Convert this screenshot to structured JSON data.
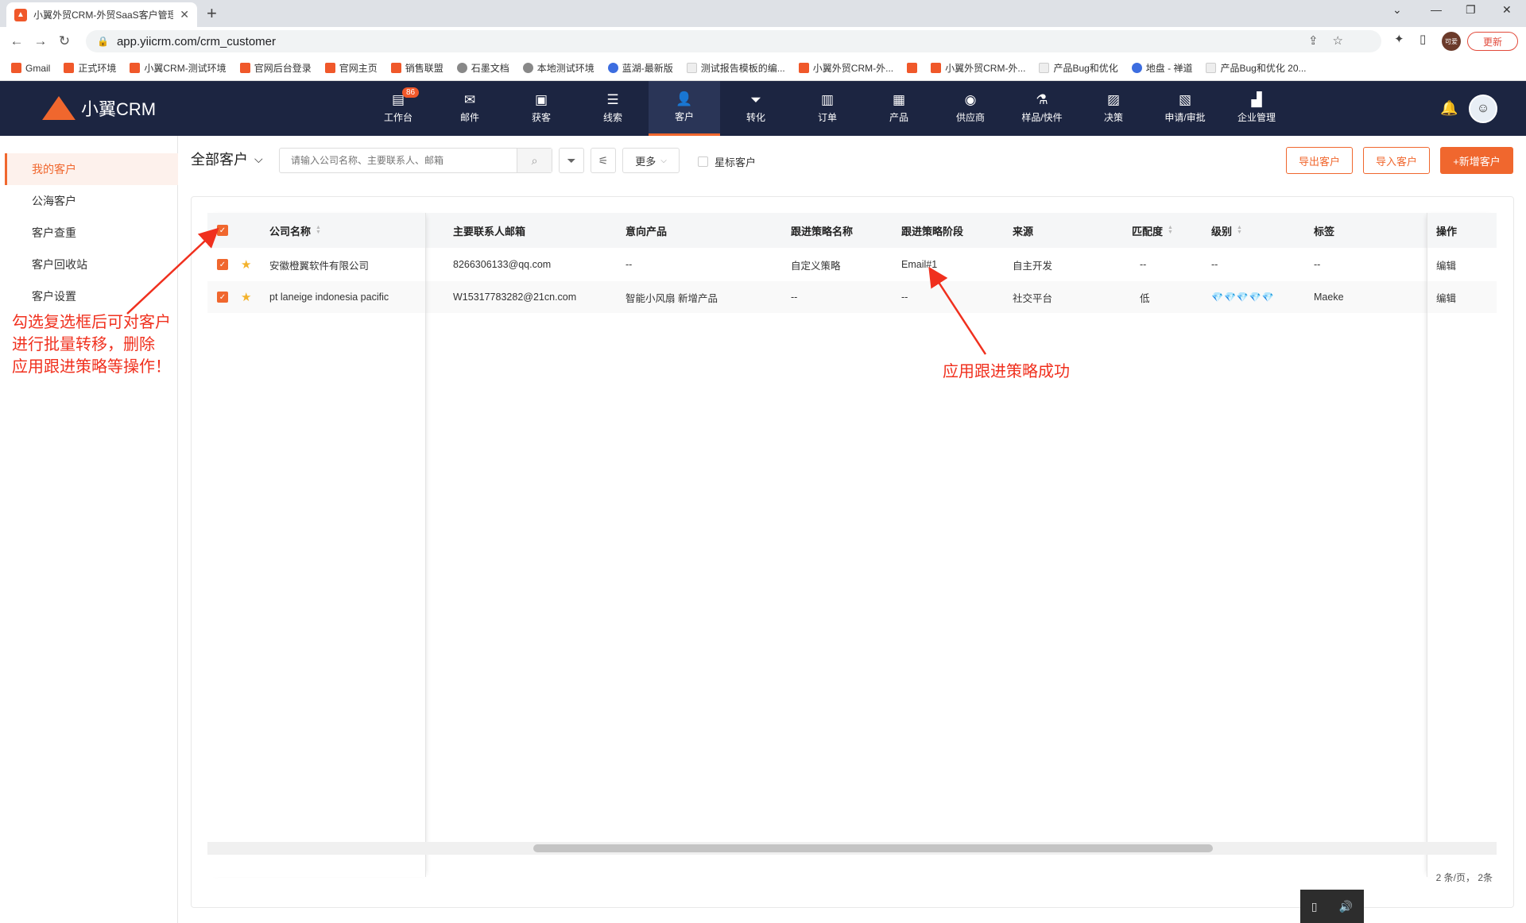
{
  "browser": {
    "tab_title": "小翼外贸CRM-外贸SaaS客户管理",
    "url": "app.yiicrm.com/crm_customer",
    "update_label": "更新",
    "profile_label": "可爱",
    "bookmarks": [
      {
        "label": "Gmail",
        "icon": "gmail-icon"
      },
      {
        "label": "正式环境",
        "icon": "app-icon"
      },
      {
        "label": "小翼CRM-测试环境",
        "icon": "app-icon"
      },
      {
        "label": "官网后台登录",
        "icon": "app-icon"
      },
      {
        "label": "官网主页",
        "icon": "app-icon"
      },
      {
        "label": "销售联盟",
        "icon": "app-icon"
      },
      {
        "label": "石墨文档",
        "icon": "globe-icon"
      },
      {
        "label": "本地测试环境",
        "icon": "globe-icon"
      },
      {
        "label": "蓝湖-最新版",
        "icon": "lanhu-icon"
      },
      {
        "label": "测试报告模板的编...",
        "icon": "doc-icon"
      },
      {
        "label": "小翼外贸CRM-外...",
        "icon": "app-icon"
      },
      {
        "label": "",
        "icon": "app-icon"
      },
      {
        "label": "小翼外贸CRM-外...",
        "icon": "app-icon"
      },
      {
        "label": "产品Bug和优化",
        "icon": "doc-icon"
      },
      {
        "label": "地盘 - 禅道",
        "icon": "blue-icon"
      },
      {
        "label": "产品Bug和优化 20...",
        "icon": "doc-icon"
      }
    ]
  },
  "header": {
    "logo_text": "小翼CRM",
    "nav": [
      {
        "label": "工作台",
        "icon": "workbench-icon",
        "glyph": "▤",
        "badge": "86"
      },
      {
        "label": "邮件",
        "icon": "mail-icon",
        "glyph": "✉"
      },
      {
        "label": "获客",
        "icon": "acquire-icon",
        "glyph": "▣"
      },
      {
        "label": "线索",
        "icon": "leads-icon",
        "glyph": "☰"
      },
      {
        "label": "客户",
        "icon": "customer-icon",
        "glyph": "👤",
        "active": true
      },
      {
        "label": "转化",
        "icon": "funnel-icon",
        "glyph": "⏷"
      },
      {
        "label": "订单",
        "icon": "order-icon",
        "glyph": "▥"
      },
      {
        "label": "产品",
        "icon": "product-icon",
        "glyph": "▦"
      },
      {
        "label": "供应商",
        "icon": "supplier-icon",
        "glyph": "◉"
      },
      {
        "label": "样品/快件",
        "icon": "sample-icon",
        "glyph": "⚗"
      },
      {
        "label": "决策",
        "icon": "decision-icon",
        "glyph": "▨"
      },
      {
        "label": "申请/审批",
        "icon": "approval-icon",
        "glyph": "▧"
      },
      {
        "label": "企业管理",
        "icon": "company-icon",
        "glyph": "▟"
      }
    ]
  },
  "sidebar": {
    "items": [
      {
        "label": "我的客户",
        "active": true
      },
      {
        "label": "公海客户"
      },
      {
        "label": "客户查重"
      },
      {
        "label": "客户回收站"
      },
      {
        "label": "客户设置"
      }
    ]
  },
  "toolbar": {
    "filter_title": "全部客户",
    "search_placeholder": "请输入公司名称、主要联系人、邮箱",
    "more_label": "更多",
    "star_filter_label": "星标客户",
    "export_label": "导出客户",
    "import_label": "导入客户",
    "add_label": "+新增客户"
  },
  "table": {
    "columns": [
      "公司名称",
      "主要联系人邮箱",
      "意向产品",
      "跟进策略名称",
      "跟进策略阶段",
      "来源",
      "匹配度",
      "级别",
      "标签",
      "操作"
    ],
    "rows": [
      {
        "company": "安徽橙翼软件有限公司",
        "email": "8266306133@qq.com",
        "product": "--",
        "strategy": "自定义策略",
        "stage": "Email#1",
        "source": "自主开发",
        "match": "--",
        "level": "--",
        "tag": "--",
        "action": "编辑"
      },
      {
        "company": "pt laneige indonesia pacific",
        "email": "W15317783282@21cn.com",
        "product": "智能小风扇 新增产品",
        "strategy": "--",
        "stage": "--",
        "source": "社交平台",
        "match": "低",
        "level": "💎💎💎💎💎",
        "tag": "Maeke",
        "action": "编辑"
      }
    ],
    "pagination": "2 条/页，  2条"
  },
  "annotations": {
    "left_note": [
      "勾选复选框后可对客户",
      "进行批量转移，删除",
      "应用跟进策略等操作！"
    ],
    "right_note": "应用跟进策略成功",
    "color": "#f0301e"
  },
  "colors": {
    "accent": "#f0672e",
    "header_bg": "#1c2541"
  }
}
